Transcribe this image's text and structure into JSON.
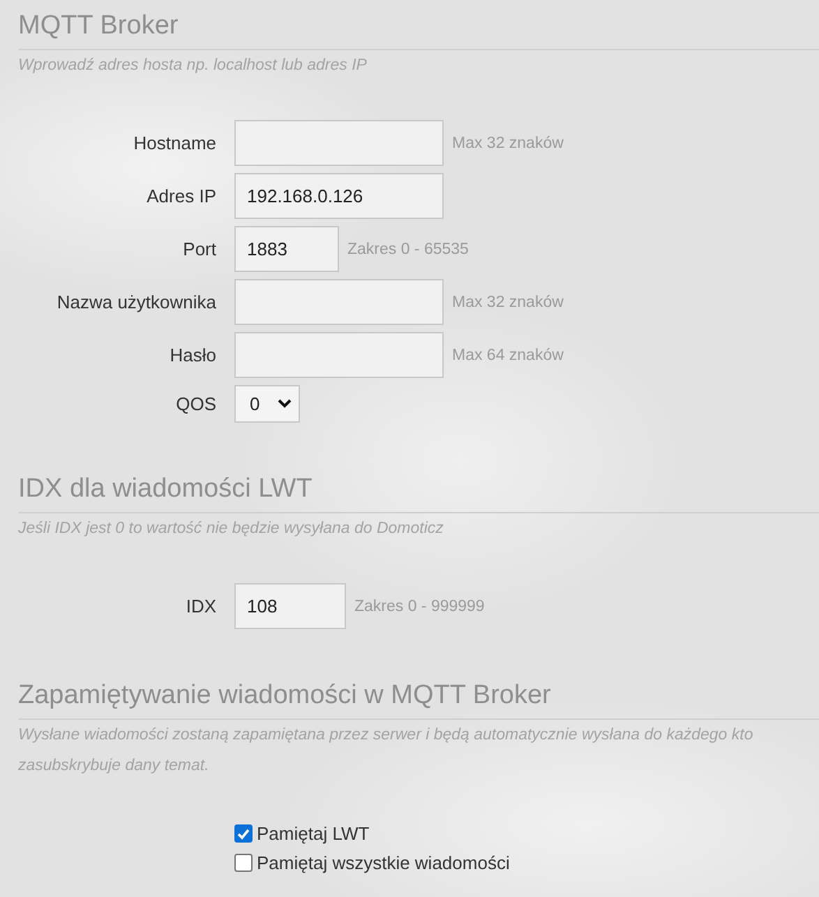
{
  "sections": [
    {
      "title": "MQTT Broker",
      "description": "Wprowadź adres hosta np. localhost lub adres IP",
      "fields": [
        {
          "kind": "text",
          "label": "Hostname",
          "hint": "Max 32 znaków"
        },
        {
          "kind": "text",
          "label": "Adres IP",
          "value": "192.168.0.126"
        },
        {
          "kind": "number",
          "label": "Port",
          "value": "1883",
          "hint": "Zakres 0 - 65535"
        },
        {
          "kind": "text",
          "label": "Nazwa użytkownika",
          "hint": "Max 32 znaków"
        },
        {
          "kind": "text",
          "label": "Hasło",
          "hint": "Max 64 znaków"
        },
        {
          "kind": "select",
          "label": "QOS",
          "value": "0"
        }
      ]
    },
    {
      "title": "IDX dla wiadomości LWT",
      "description": "Jeśli IDX jest 0 to wartość nie będzie wysyłana do Domoticz",
      "fields": [
        {
          "kind": "number",
          "label": "IDX",
          "value": "108",
          "hint": "Zakres 0 - 999999"
        }
      ]
    },
    {
      "title": "Zapamiętywanie wiadomości w MQTT Broker",
      "description": "Wysłane wiadomości zostaną zapamiętana przez serwer i będą automatycznie wysłana do każdego kto zasubskrybuje dany temat.",
      "fields": [
        {
          "kind": "checkbox",
          "label": "Pamiętaj LWT",
          "checked": true
        },
        {
          "kind": "checkbox",
          "label": "Pamiętaj wszystkie wiadomości",
          "checked": false
        }
      ]
    }
  ]
}
